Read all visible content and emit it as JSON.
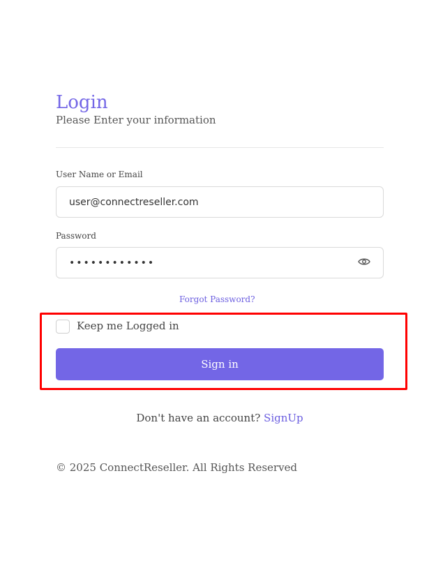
{
  "login": {
    "title": "Login",
    "subtitle": "Please Enter your information",
    "username_label": "User Name or Email",
    "username_value": "user@connectreseller.com",
    "password_label": "Password",
    "password_value": "••••••••••••",
    "show_password_icon": "eye-icon",
    "forgot_password": "Forgot Password?",
    "keep_logged_in": "Keep me Logged in",
    "keep_logged_in_checked": false,
    "sign_in": "Sign in"
  },
  "signup": {
    "prompt": "Don't have an account?",
    "link": "SignUp"
  },
  "footer": {
    "copyright": "© 2025 ConnectReseller. All Rights Reserved"
  },
  "colors": {
    "accent": "#7366e6",
    "highlight": "#ff0000"
  }
}
